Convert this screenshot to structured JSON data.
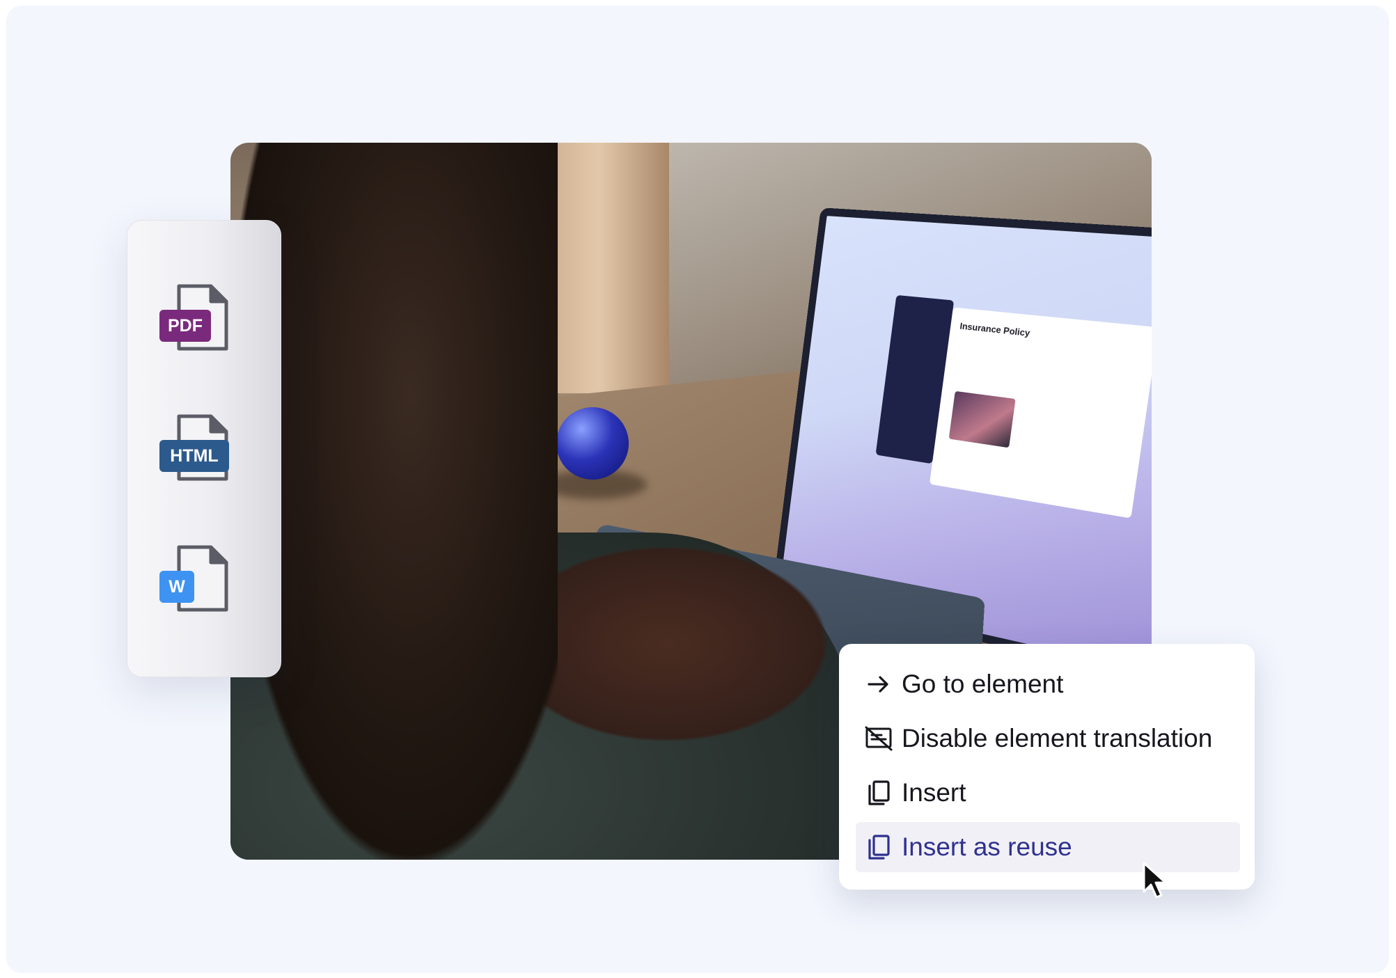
{
  "file_formats": [
    {
      "label": "PDF",
      "icon": "pdf-file-icon",
      "color": "#7a2a7d"
    },
    {
      "label": "HTML",
      "icon": "html-file-icon",
      "color": "#2d5a8c"
    },
    {
      "label": "W",
      "icon": "word-file-icon",
      "color": "#3e93f2"
    }
  ],
  "context_menu": {
    "items": [
      {
        "label": "Go to element",
        "icon": "arrow-right-icon"
      },
      {
        "label": "Disable element translation",
        "icon": "translation-off-icon"
      },
      {
        "label": "Insert",
        "icon": "copy-icon"
      },
      {
        "label": "Insert as reuse",
        "icon": "copy-icon",
        "active": true
      }
    ]
  },
  "laptop_screen": {
    "document_title": "Insurance Policy"
  },
  "colors": {
    "background": "#f3f6fd",
    "menu_active_bg": "#f1f0f6",
    "menu_active_text": "#2f3190"
  }
}
